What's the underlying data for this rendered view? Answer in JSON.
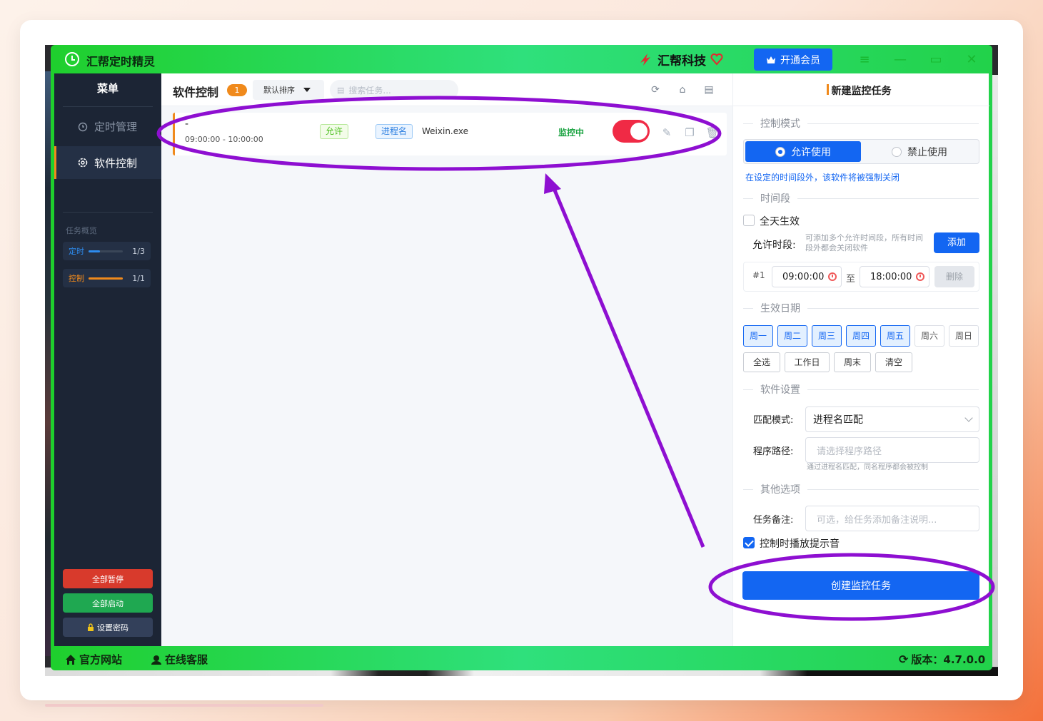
{
  "app": {
    "title": "汇帮定时精灵",
    "brand": "汇帮科技",
    "vip_button": "开通会员",
    "colors": {
      "accent": "#1366f2",
      "frame": "#22d24a",
      "sidebar": "#1c2535",
      "warning": "#f08a1c",
      "danger": "#f02a45",
      "annotation": "#8e0fd1"
    }
  },
  "sidebar": {
    "title": "菜单",
    "items": [
      {
        "label": "定时管理",
        "icon": "alarm-clock-icon",
        "active": false
      },
      {
        "label": "软件控制",
        "icon": "gear-icon",
        "active": true
      }
    ],
    "overview_title": "任务概览",
    "overview": [
      {
        "label": "定时",
        "value": "1/3",
        "fraction": 0.33,
        "color": "#2d8cf0"
      },
      {
        "label": "控制",
        "value": "1/1",
        "fraction": 1.0,
        "color": "#f08a1c"
      }
    ],
    "buttons": {
      "pause_all": "全部暂停",
      "start_all": "全部启动",
      "set_password": "设置密码"
    }
  },
  "main": {
    "title": "软件控制",
    "count": "1",
    "sort": "默认排序",
    "search_placeholder": "搜索任务...",
    "tasks": [
      {
        "name": "-",
        "time": "09:00:00 - 10:00:00",
        "mode_tag": "允许",
        "type_tag": "进程名",
        "process": "Weixin.exe",
        "status": "监控中",
        "enabled": true
      }
    ]
  },
  "form": {
    "title": "新建监控任务",
    "control_mode_section": "控制模式",
    "mode_allow": "允许使用",
    "mode_forbid": "禁止使用",
    "mode_hint": "在设定的时间段外，该软件将被强制关闭",
    "time_section": "时间段",
    "all_day": "全天生效",
    "allowed_period_label": "允许时段:",
    "allowed_period_hint": "可添加多个允许时间段，所有时间段外都会关闭软件",
    "add_button": "添加",
    "period_index": "#1",
    "start_time": "09:00:00",
    "to_label": "至",
    "end_time": "18:00:00",
    "delete_button": "删除",
    "date_section": "生效日期",
    "days": [
      {
        "label": "周一",
        "selected": true
      },
      {
        "label": "周二",
        "selected": true
      },
      {
        "label": "周三",
        "selected": true
      },
      {
        "label": "周四",
        "selected": true
      },
      {
        "label": "周五",
        "selected": true
      },
      {
        "label": "周六",
        "selected": false
      },
      {
        "label": "周日",
        "selected": false
      }
    ],
    "quick": [
      "全选",
      "工作日",
      "周末",
      "清空"
    ],
    "software_section": "软件设置",
    "match_mode_label": "匹配模式:",
    "match_mode_value": "进程名匹配",
    "path_label": "程序路径:",
    "path_placeholder": "请选择程序路径",
    "path_hint": "通过进程名匹配，同名程序都会被控制",
    "other_section": "其他选项",
    "note_label": "任务备注:",
    "note_placeholder": "可选，给任务添加备注说明...",
    "play_sound": "控制时播放提示音",
    "play_sound_checked": true,
    "create_button": "创建监控任务"
  },
  "footer": {
    "website": "官方网站",
    "support": "在线客服",
    "version": "版本：4.7.0.0"
  }
}
